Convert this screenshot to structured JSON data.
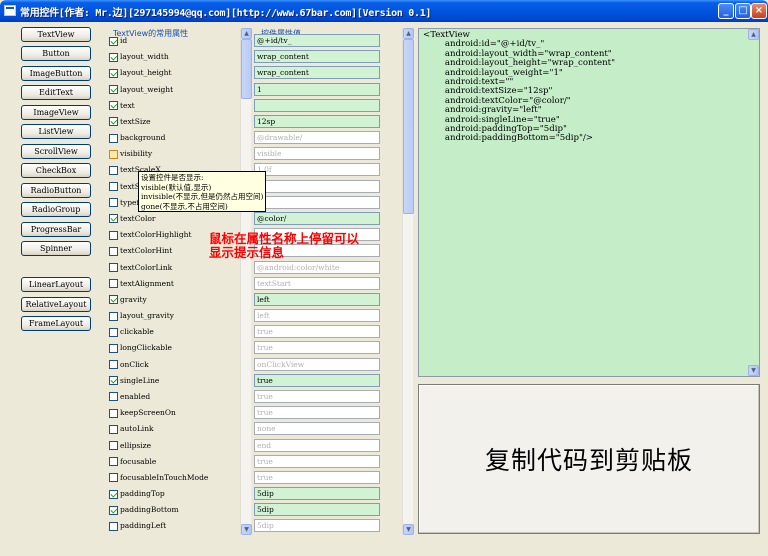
{
  "window": {
    "title": "常用控件[作者: Mr.边][297145994@qq.com][http://www.67bar.com][Version 0.1]",
    "minimize": "_",
    "maximize": "□",
    "close": "×"
  },
  "widgets": [
    "TextView",
    "Button",
    "ImageButton",
    "EditText",
    "ImageView",
    "ListView",
    "ScrollView",
    "CheckBox",
    "RadioButton",
    "RadioGroup",
    "ProgressBar",
    "Spinner"
  ],
  "layouts": [
    "LinearLayout",
    "RelativeLayout",
    "FrameLayout"
  ],
  "props_header": "TextView的常用属性",
  "values_header": "控件属性值",
  "properties": [
    {
      "name": "id",
      "checked": true,
      "value": "@+id/tv_"
    },
    {
      "name": "layout_width",
      "checked": true,
      "value": "wrap_content"
    },
    {
      "name": "layout_height",
      "checked": true,
      "value": "wrap_content"
    },
    {
      "name": "layout_weight",
      "checked": true,
      "value": "1"
    },
    {
      "name": "text",
      "checked": true,
      "value": ""
    },
    {
      "name": "textSize",
      "checked": true,
      "value": "12sp"
    },
    {
      "name": "background",
      "checked": false,
      "value": "@drawable/"
    },
    {
      "name": "visibility",
      "checked": false,
      "value": "visible"
    },
    {
      "name": "textScaleX",
      "checked": false,
      "value": "1.0f"
    },
    {
      "name": "textStyle",
      "checked": false,
      "value": ""
    },
    {
      "name": "typeface",
      "checked": false,
      "value": ""
    },
    {
      "name": "textColor",
      "checked": true,
      "value": "@color/"
    },
    {
      "name": "textColorHighlight",
      "checked": false,
      "value": ""
    },
    {
      "name": "textColorHint",
      "checked": false,
      "value": ""
    },
    {
      "name": "textColorLink",
      "checked": false,
      "value": "@android:color/white"
    },
    {
      "name": "textAlignment",
      "checked": false,
      "value": "textStart"
    },
    {
      "name": "gravity",
      "checked": true,
      "value": "left"
    },
    {
      "name": "layout_gravity",
      "checked": false,
      "value": "left"
    },
    {
      "name": "clickable",
      "checked": false,
      "value": "true"
    },
    {
      "name": "longClickable",
      "checked": false,
      "value": "true"
    },
    {
      "name": "onClick",
      "checked": false,
      "value": "onClickView"
    },
    {
      "name": "singleLine",
      "checked": true,
      "value": "true"
    },
    {
      "name": "enabled",
      "checked": false,
      "value": "true"
    },
    {
      "name": "keepScreenOn",
      "checked": false,
      "value": "true"
    },
    {
      "name": "autoLink",
      "checked": false,
      "value": "none"
    },
    {
      "name": "ellipsize",
      "checked": false,
      "value": "end"
    },
    {
      "name": "focusable",
      "checked": false,
      "value": "true"
    },
    {
      "name": "focusableInTouchMode",
      "checked": false,
      "value": "true"
    },
    {
      "name": "paddingTop",
      "checked": true,
      "value": "5dip"
    },
    {
      "name": "paddingBottom",
      "checked": true,
      "value": "5dip"
    },
    {
      "name": "paddingLeft",
      "checked": false,
      "value": "5dip"
    }
  ],
  "tooltip": {
    "text": "设置控件是否显示:\nvisible(默认值,显示)\ninvisible(不显示,但是仍然占用空间)\ngone(不显示,不占用空间)"
  },
  "annotation": "鼠标在属性名称上停留可以\n显示提示信息",
  "code": "<TextView\n        android:id=\"@+id/tv_\"\n        android:layout_width=\"wrap_content\"\n        android:layout_height=\"wrap_content\"\n        android:layout_weight=\"1\"\n        android:text=\"\"\n        android:textSize=\"12sp\"\n        android:textColor=\"@color/\"\n        android:gravity=\"left\"\n        android:singleLine=\"true\"\n        android:paddingTop=\"5dip\"\n        android:paddingBottom=\"5dip\"/>",
  "copy_button": "复制代码到剪贴板",
  "colors": {
    "checked_value_bg": "#d2f2d4",
    "code_bg": "#c4edc8",
    "annotation": "#ff0000",
    "titlebar": "#0056e0"
  }
}
